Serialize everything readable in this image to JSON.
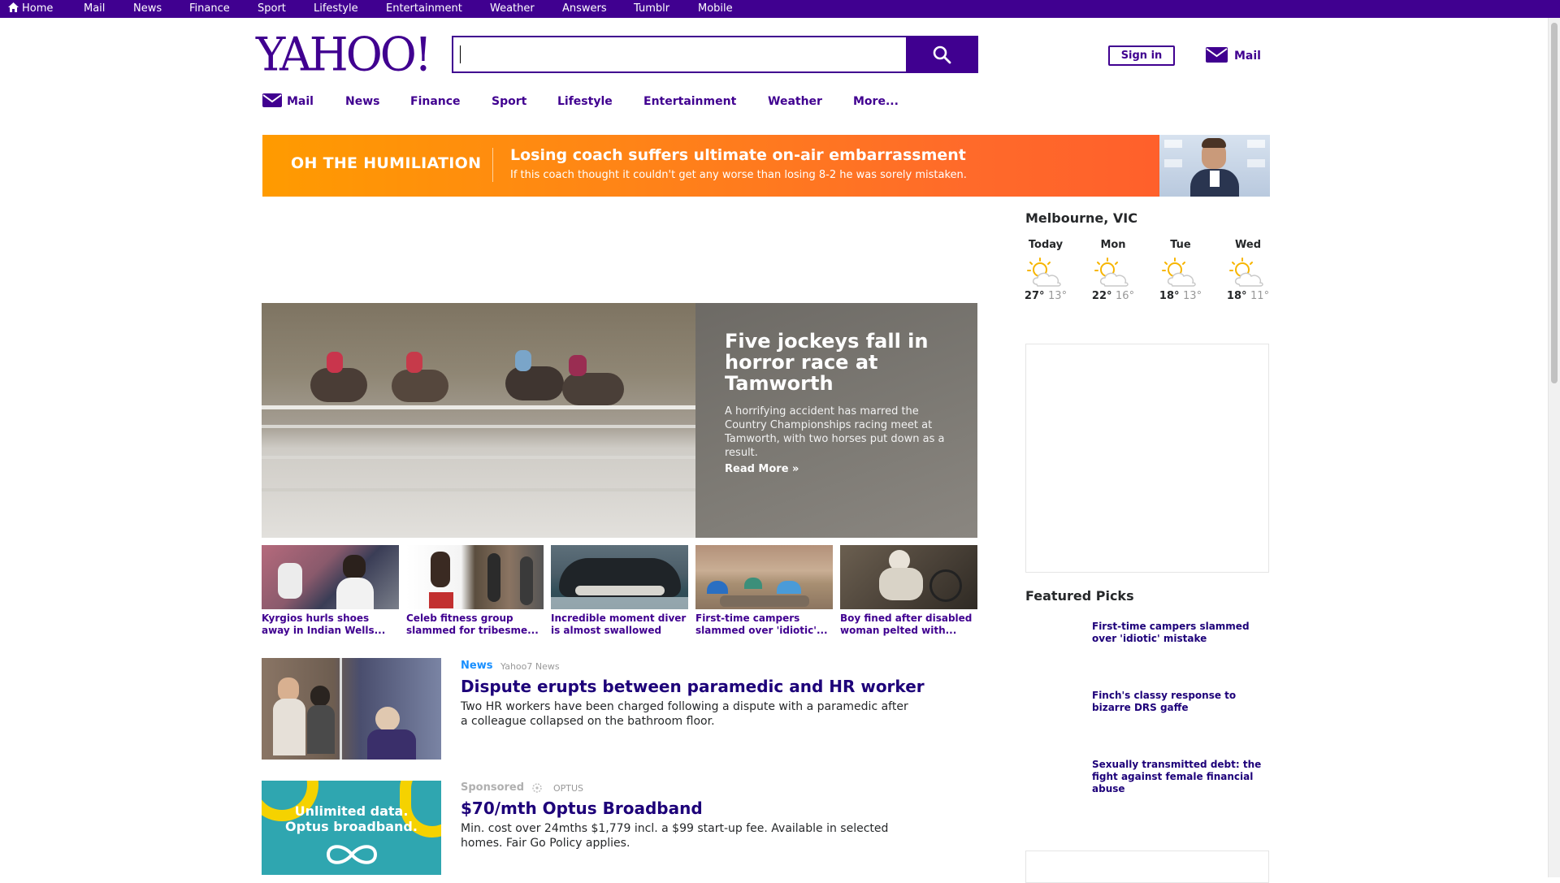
{
  "topbar": {
    "items": [
      "Home",
      "Mail",
      "News",
      "Finance",
      "Sport",
      "Lifestyle",
      "Entertainment",
      "Weather",
      "Answers",
      "Tumblr",
      "Mobile"
    ]
  },
  "logo": {
    "text": "YAHOO!"
  },
  "search": {
    "value": "",
    "icon": "search-icon"
  },
  "header": {
    "signin_label": "Sign in",
    "mail_label": "Mail"
  },
  "nav": {
    "items": [
      "Mail",
      "News",
      "Finance",
      "Sport",
      "Lifestyle",
      "Entertainment",
      "Weather",
      "More..."
    ]
  },
  "promo": {
    "tag": "OH THE HUMILIATION",
    "headline": "Losing coach suffers ultimate on-air embarrassment",
    "subtext": "If this coach thought it couldn't get any worse than losing 8-2 he was sorely mistaken."
  },
  "hero": {
    "title": "Five jockeys fall in horror race at Tamworth",
    "summary": "A horrifying accident has marred the Country Championships racing meet at Tamworth, with two horses put down as a result.",
    "read_more": "Read More »"
  },
  "thumbs": [
    {
      "caption": "Kyrgios hurls shoes away in Indian Wells..."
    },
    {
      "caption": "Celeb fitness group slammed for tribesme..."
    },
    {
      "caption": "Incredible moment diver is almost swallowed by..."
    },
    {
      "caption": "First-time campers slammed over 'idiotic'..."
    },
    {
      "caption": "Boy fined after disabled woman pelted with..."
    }
  ],
  "stream": [
    {
      "label": "News",
      "source": "Yahoo7 News",
      "title": "Dispute erupts between paramedic and HR worker",
      "summary": "Two HR workers have been charged following a dispute with a paramedic after a colleague collapsed on the bathroom floor."
    },
    {
      "label": "Sponsored",
      "source": "OPTUS",
      "title": "$70/mth Optus Broadband",
      "summary": "Min. cost over 24mths $1,779 incl. a $99 start-up fee. Available in selected homes. Fair Go Policy applies.",
      "ad_line1": "Unlimited data.",
      "ad_line2": "Optus broadband."
    }
  ],
  "weather": {
    "location": "Melbourne, VIC",
    "days": [
      {
        "name": "Today",
        "high": "27°",
        "low": "13°",
        "icon": "partly-sunny-icon"
      },
      {
        "name": "Mon",
        "high": "22°",
        "low": "16°",
        "icon": "partly-sunny-icon"
      },
      {
        "name": "Tue",
        "high": "18°",
        "low": "13°",
        "icon": "partly-sunny-icon"
      },
      {
        "name": "Wed",
        "high": "18°",
        "low": "11°",
        "icon": "partly-sunny-icon"
      }
    ]
  },
  "featured": {
    "title": "Featured Picks",
    "items": [
      "First-time campers slammed over 'idiotic' mistake",
      "Finch's classy response to bizarre DRS gaffe",
      "Sexually transmitted debt: the fight against female financial abuse"
    ]
  },
  "colors": {
    "brand_purple": "#400090",
    "link_blue": "#1d0079",
    "news_label": "#188fff",
    "promo_orange": "#ff8516"
  }
}
